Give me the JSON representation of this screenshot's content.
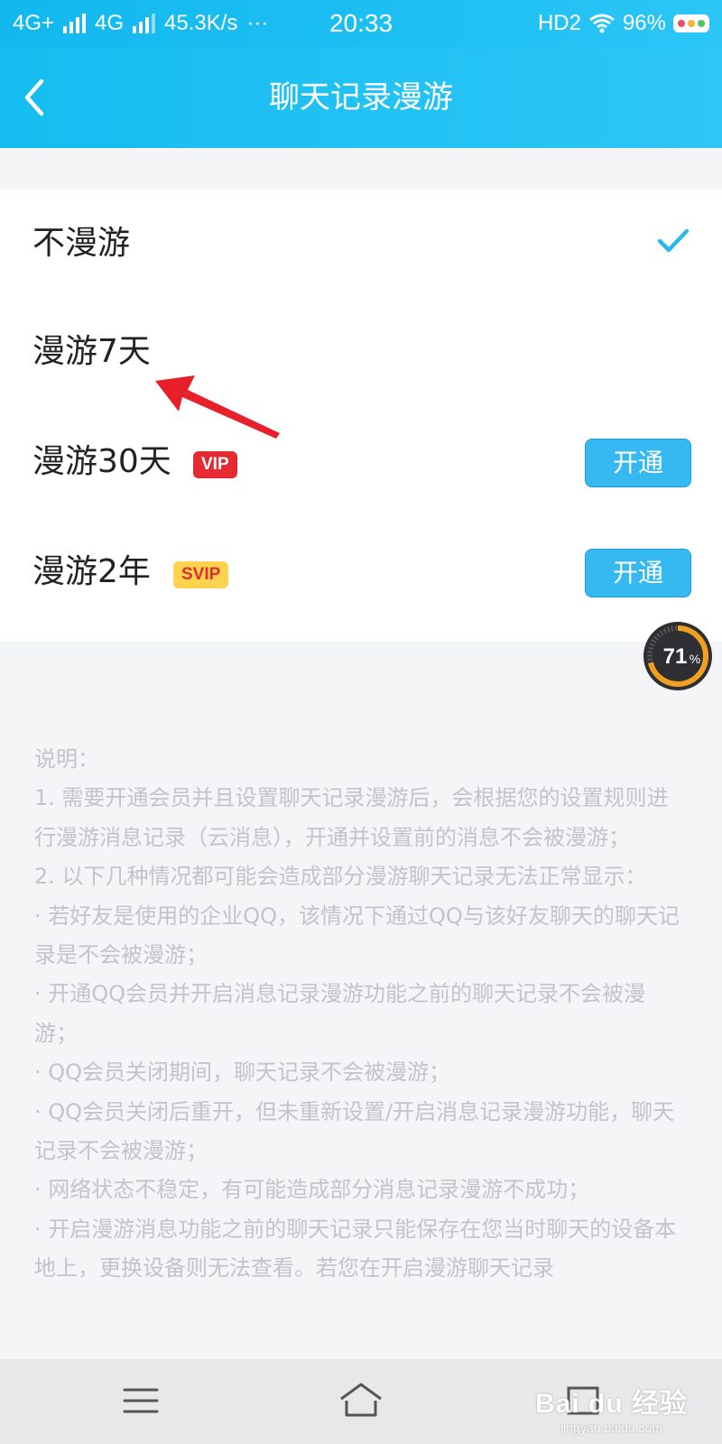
{
  "status_bar": {
    "network1": "4G+",
    "network2": "4G",
    "speed": "45.3K/s",
    "more": "···",
    "time": "20:33",
    "hd": "HD2",
    "battery": "96%"
  },
  "header": {
    "title": "聊天记录漫游"
  },
  "options": [
    {
      "label": "不漫游",
      "selected": true
    },
    {
      "label": "漫游7天",
      "selected": false
    },
    {
      "label": "漫游30天",
      "badge": "VIP",
      "button": "开通",
      "selected": false
    },
    {
      "label": "漫游2年",
      "badge": "SVIP",
      "button": "开通",
      "selected": false
    }
  ],
  "progress_widget": {
    "value": "71",
    "unit": "%",
    "fraction": 0.71
  },
  "description": [
    "说明：",
    "1. 需要开通会员并且设置聊天记录漫游后，会根据您的设置规则进行漫游消息记录（云消息），开通并设置前的消息不会被漫游；",
    "2. 以下几种情况都可能会造成部分漫游聊天记录无法正常显示：",
    "· 若好友是使用的企业QQ，该情况下通过QQ与该好友聊天的聊天记录是不会被漫游；",
    "· 开通QQ会员并开启消息记录漫游功能之前的聊天记录不会被漫游；",
    "· QQ会员关闭期间，聊天记录不会被漫游；",
    "· QQ会员关闭后重开，但未重新设置/开启消息记录漫游功能，聊天记录不会被漫游；",
    "· 网络状态不稳定，有可能造成部分消息记录漫游不成功；",
    "· 开启漫游消息功能之前的聊天记录只能保存在您当时聊天的设备本地上，更换设备则无法查看。若您在开启漫游聊天记录"
  ],
  "watermark": {
    "logo": "Bai du 经验",
    "url": "jingyan.baidu.com"
  },
  "colors": {
    "header": "#1ec0f3",
    "open_button": "#36b8f0",
    "check": "#2cb8ee",
    "vip_badge": "#e62a33",
    "svip_badge": "#ffd34d",
    "annotation_arrow": "#e8202a"
  },
  "icons": {
    "back": "back-chevron-icon",
    "check": "checkmark-icon",
    "menu": "menu-icon",
    "home": "home-icon",
    "recent": "recent-apps-icon"
  }
}
